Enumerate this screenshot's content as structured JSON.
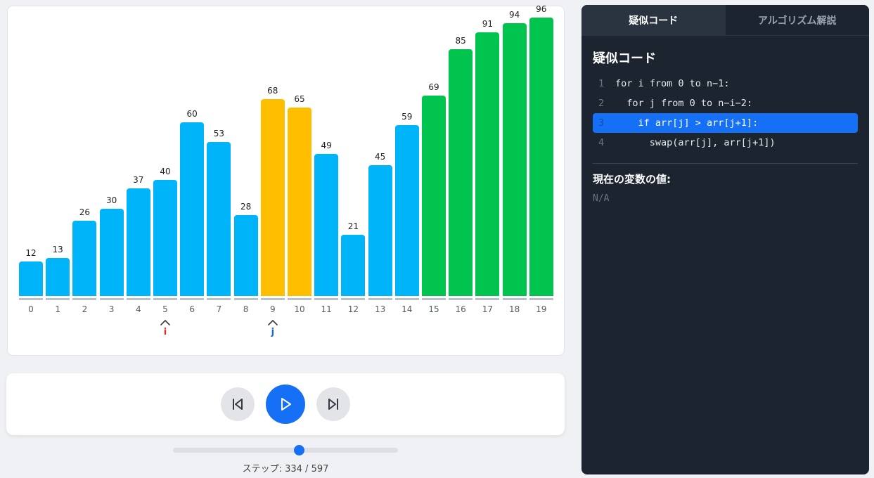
{
  "visualization": {
    "values": [
      12,
      13,
      26,
      30,
      37,
      40,
      60,
      53,
      28,
      68,
      65,
      49,
      21,
      45,
      59,
      69,
      85,
      91,
      94,
      96
    ],
    "indices": [
      "0",
      "1",
      "2",
      "3",
      "4",
      "5",
      "6",
      "7",
      "8",
      "9",
      "10",
      "11",
      "12",
      "13",
      "14",
      "15",
      "16",
      "17",
      "18",
      "19"
    ],
    "states": [
      "default",
      "default",
      "default",
      "default",
      "default",
      "default",
      "default",
      "default",
      "default",
      "comparing",
      "comparing",
      "default",
      "default",
      "default",
      "default",
      "sorted",
      "sorted",
      "sorted",
      "sorted",
      "sorted"
    ],
    "pointers": [
      {
        "label": "i",
        "index": 5,
        "color": "#e0262f"
      },
      {
        "label": "j",
        "index": 9,
        "color": "#1463d6"
      }
    ],
    "colors": {
      "default": "#00b4fa",
      "comparing": "#ffbf00",
      "sorted": "#00c44e"
    }
  },
  "controls": {
    "prev_icon": "skip-back-icon",
    "play_icon": "play-icon",
    "next_icon": "skip-forward-icon"
  },
  "progress": {
    "current": 334,
    "total": 597,
    "label": "ステップ: 334 / 597"
  },
  "code_panel": {
    "tabs": [
      {
        "label": "疑似コード",
        "active": true
      },
      {
        "label": "アルゴリズム解説",
        "active": false
      }
    ],
    "title": "疑似コード",
    "lines": [
      {
        "no": "1",
        "text": "for i from 0 to n−1:"
      },
      {
        "no": "2",
        "text": "  for j from 0 to n−i−2:"
      },
      {
        "no": "3",
        "text": "    if arr[j] > arr[j+1]:"
      },
      {
        "no": "4",
        "text": "      swap(arr[j], arr[j+1])"
      }
    ],
    "highlighted_line": 3,
    "vars_title": "現在の変数の値:",
    "vars_value": "N/A"
  }
}
